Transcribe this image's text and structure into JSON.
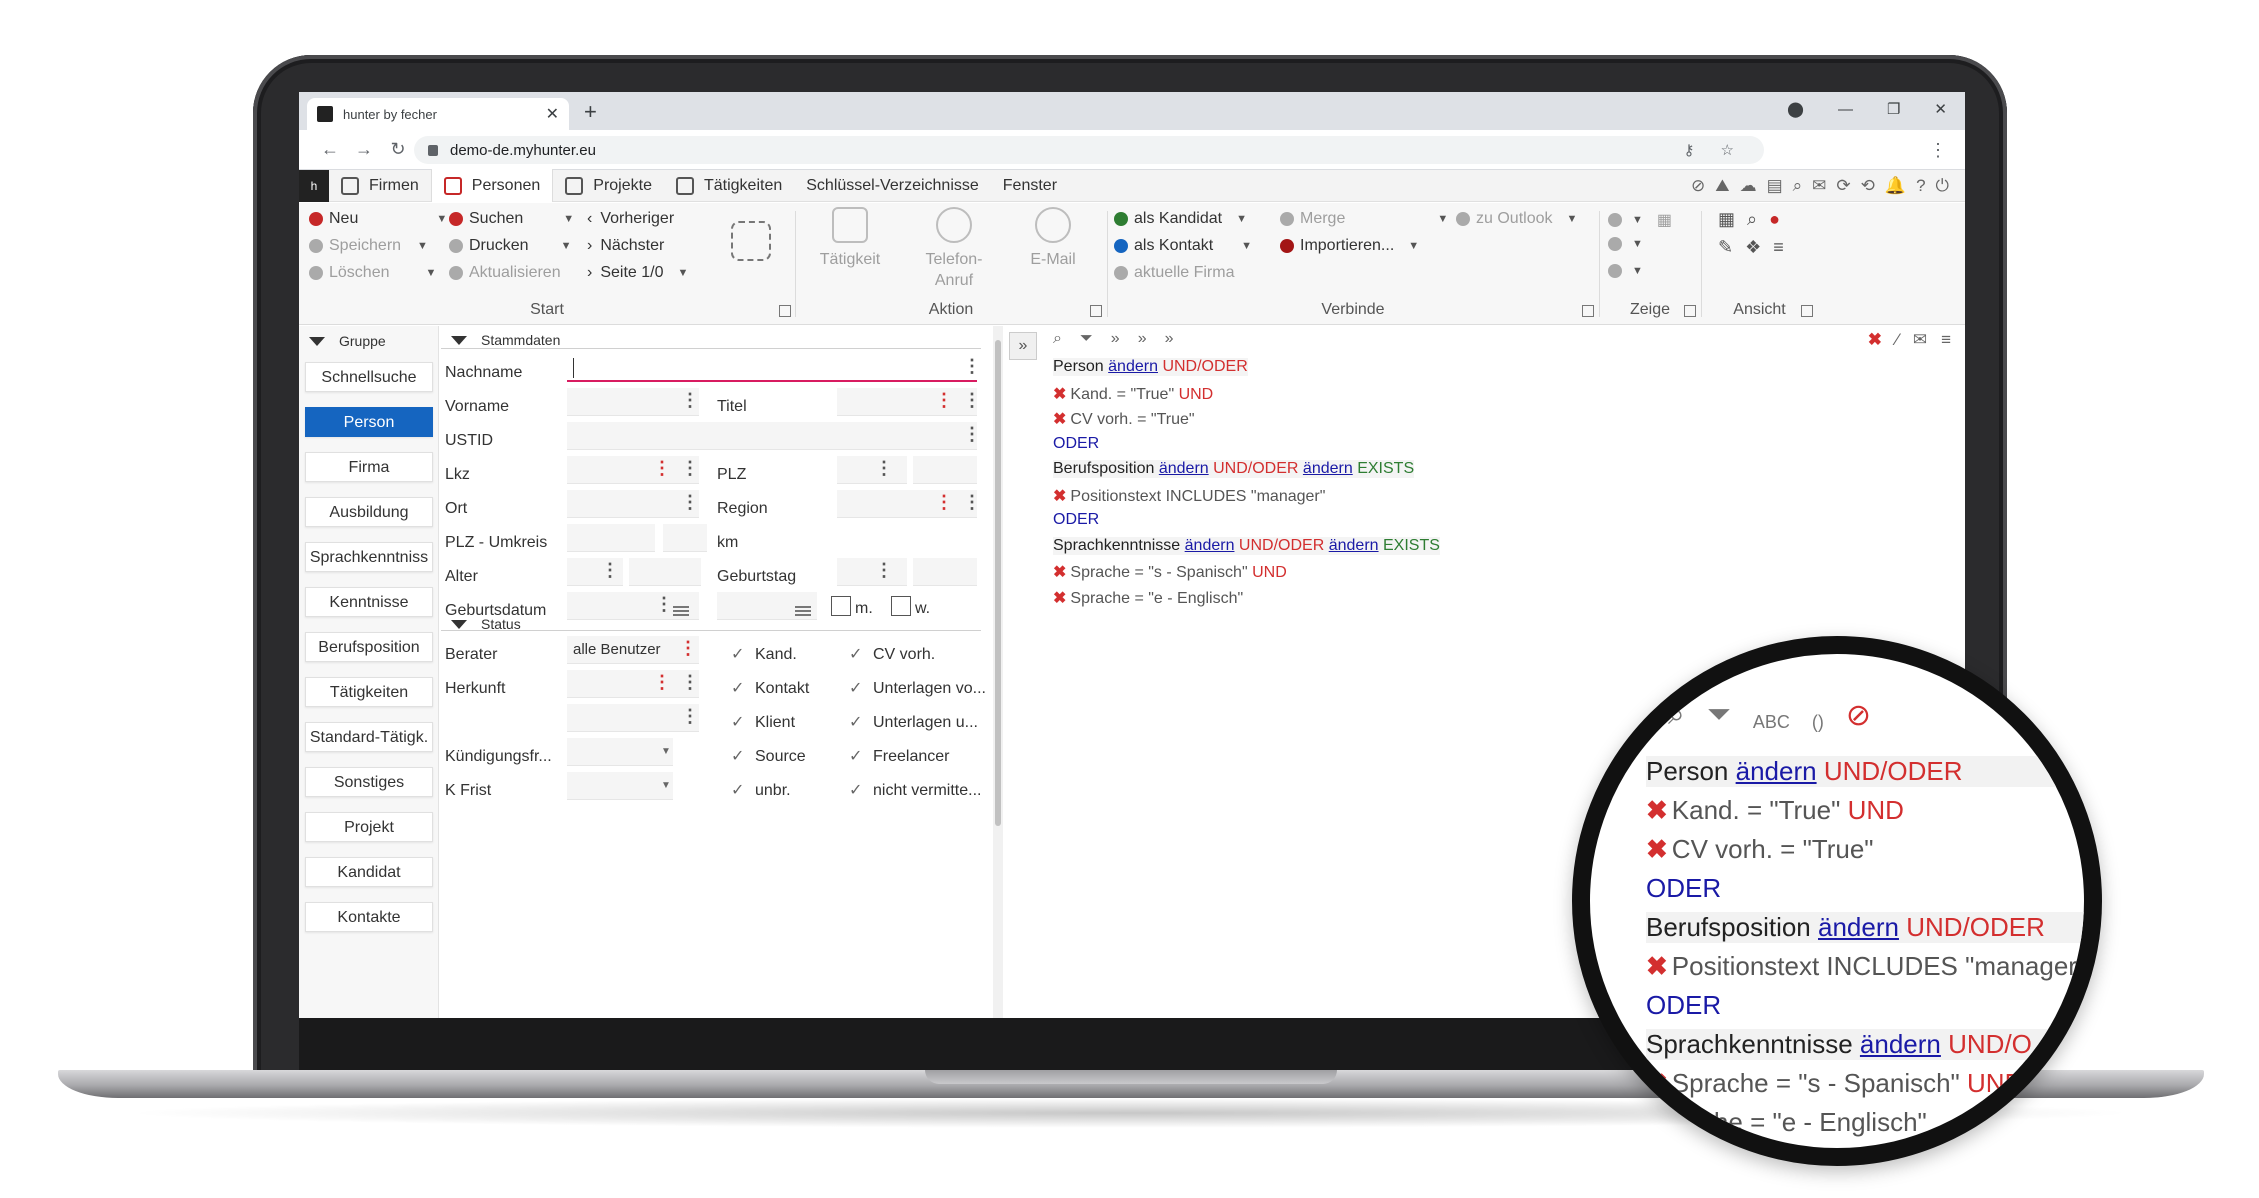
{
  "browser": {
    "tab_title": "hunter by fecher",
    "tab_close": "✕",
    "new_tab": "+",
    "url": "demo-de.myhunter.eu",
    "back": "←",
    "forward": "→",
    "reload": "↻",
    "menu": "⋮",
    "win_profile": "⬤",
    "win_min": "—",
    "win_max": "❐",
    "win_close": "✕",
    "key_icon": "⚷",
    "star_icon": "☆"
  },
  "menubar": {
    "logo": "h",
    "items": [
      {
        "label": "Firmen",
        "icon": "building-icon"
      },
      {
        "label": "Personen",
        "icon": "person-search-icon"
      },
      {
        "label": "Projekte",
        "icon": "project-icon"
      },
      {
        "label": "Tätigkeiten",
        "icon": "calendar-icon"
      },
      {
        "label": "Schlüssel-Verzeichnisse",
        "icon": ""
      },
      {
        "label": "Fenster",
        "icon": ""
      }
    ],
    "right_icons": [
      "⊘",
      "⛰",
      "☁",
      "▤",
      "⌕",
      "✉",
      "⟳",
      "⟲",
      "🔔",
      "?",
      "⏻"
    ]
  },
  "ribbon": {
    "start": {
      "label": "Start",
      "col1": [
        "Neu",
        "Speichern",
        "Löschen"
      ],
      "col2": [
        "Suchen",
        "Drucken",
        "Aktualisieren"
      ],
      "col3": [
        "Vorheriger",
        "Nächster",
        "Seite 1/0"
      ]
    },
    "aktion": {
      "label": "Aktion",
      "taetigkeit": "Tätigkeit",
      "telefon": "Telefon-\nAnruf",
      "email": "E-Mail"
    },
    "verbinde": {
      "label": "Verbinde",
      "col1": [
        "als Kandidat",
        "als Kontakt",
        "aktuelle Firma"
      ],
      "col2": [
        "Merge",
        "Importieren..."
      ],
      "col3": [
        "zu Outlook"
      ]
    },
    "zeige": {
      "label": "Zeige"
    },
    "ansicht": {
      "label": "Ansicht"
    }
  },
  "leftnav": {
    "group_label": "Gruppe",
    "items": [
      "Schnellsuche",
      "Person",
      "Firma",
      "Ausbildung",
      "Sprachkenntniss",
      "Kenntnisse",
      "Berufsposition",
      "Tätigkeiten",
      "Standard-Tätigk.",
      "Sonstiges",
      "Projekt",
      "Kandidat",
      "Kontakte"
    ],
    "selected": "Person"
  },
  "form": {
    "section_stammdaten": "Stammdaten",
    "section_status": "Status",
    "labels": {
      "nachname": "Nachname",
      "vorname": "Vorname",
      "titel": "Titel",
      "ustid": "USTID",
      "lkz": "Lkz",
      "plz": "PLZ",
      "ort": "Ort",
      "region": "Region",
      "plz_umkreis": "PLZ - Umkreis",
      "km": "km",
      "alter": "Alter",
      "geburtstag": "Geburtstag",
      "geburtsdatum": "Geburtsdatum",
      "m": "m.",
      "w": "w.",
      "berater": "Berater",
      "herkunft": "Herkunft",
      "kuendigungsfr": "Kündigungsfr...",
      "k_frist": "K Frist"
    },
    "berater_value": "alle Benutzer",
    "status_checks": [
      {
        "label": "Kand.",
        "checked": true
      },
      {
        "label": "CV vorh.",
        "checked": true
      },
      {
        "label": "Kontakt",
        "checked": true
      },
      {
        "label": "Unterlagen vo...",
        "checked": true
      },
      {
        "label": "Klient",
        "checked": true
      },
      {
        "label": "Unterlagen u...",
        "checked": true
      },
      {
        "label": "Source",
        "checked": true
      },
      {
        "label": "Freelancer",
        "checked": true
      },
      {
        "label": "unbr.",
        "checked": true
      },
      {
        "label": "nicht vermitte...",
        "checked": true
      }
    ]
  },
  "query": {
    "expand": "»",
    "lines": [
      {
        "parts": [
          {
            "t": "Person",
            "c": "b"
          },
          {
            "t": " "
          },
          {
            "t": "ändern",
            "c": "link"
          },
          {
            "t": " "
          },
          {
            "t": "UND/ODER",
            "c": "red"
          }
        ]
      },
      {
        "parts": [
          {
            "t": "✖",
            "c": "x"
          },
          {
            "t": "Kand. = \"True\" ",
            "c": "grey"
          },
          {
            "t": "UND",
            "c": "red"
          }
        ]
      },
      {
        "parts": [
          {
            "t": "✖",
            "c": "x"
          },
          {
            "t": "CV vorh. = \"True\"",
            "c": "grey"
          }
        ]
      },
      {
        "parts": [
          {
            "t": "ODER",
            "c": "blue"
          }
        ]
      },
      {
        "parts": [
          {
            "t": "Berufsposition",
            "c": "b"
          },
          {
            "t": " "
          },
          {
            "t": "ändern",
            "c": "link"
          },
          {
            "t": " "
          },
          {
            "t": "UND/ODER",
            "c": "red"
          },
          {
            "t": " "
          },
          {
            "t": "ändern",
            "c": "link"
          },
          {
            "t": " "
          },
          {
            "t": "EXISTS",
            "c": "green"
          }
        ]
      },
      {
        "parts": [
          {
            "t": "✖",
            "c": "x"
          },
          {
            "t": "Positionstext INCLUDES \"manager\"",
            "c": "grey"
          }
        ]
      },
      {
        "parts": [
          {
            "t": "ODER",
            "c": "blue"
          }
        ]
      },
      {
        "parts": [
          {
            "t": "Sprachkenntnisse",
            "c": "b"
          },
          {
            "t": " "
          },
          {
            "t": "ändern",
            "c": "link"
          },
          {
            "t": " "
          },
          {
            "t": "UND/ODER",
            "c": "red"
          },
          {
            "t": " "
          },
          {
            "t": "ändern",
            "c": "link"
          },
          {
            "t": " "
          },
          {
            "t": "EXISTS",
            "c": "green"
          }
        ]
      },
      {
        "parts": [
          {
            "t": "✖",
            "c": "x"
          },
          {
            "t": "Sprache = \"s - Spanisch\" ",
            "c": "grey"
          },
          {
            "t": "UND",
            "c": "red"
          }
        ]
      },
      {
        "parts": [
          {
            "t": "✖",
            "c": "x"
          },
          {
            "t": "Sprache = \"e - Englisch\"",
            "c": "grey"
          }
        ]
      }
    ]
  },
  "magnifier": {
    "tools": [
      "⌕",
      "⏷",
      "ABC",
      "()",
      "⊘"
    ],
    "lines": [
      {
        "parts": [
          {
            "t": "Person",
            "c": "b"
          },
          {
            "t": " "
          },
          {
            "t": "ändern",
            "c": "link"
          },
          {
            "t": " "
          },
          {
            "t": "UND/ODER",
            "c": "red"
          }
        ]
      },
      {
        "parts": [
          {
            "t": "✖",
            "c": "x"
          },
          {
            "t": "Kand. = \"True\" ",
            "c": "grey"
          },
          {
            "t": "UND",
            "c": "red"
          }
        ]
      },
      {
        "parts": [
          {
            "t": "✖",
            "c": "x"
          },
          {
            "t": "CV vorh. = \"True\"",
            "c": "grey"
          }
        ]
      },
      {
        "parts": [
          {
            "t": "ODER",
            "c": "blue"
          }
        ]
      },
      {
        "parts": [
          {
            "t": "Berufsposition",
            "c": "b"
          },
          {
            "t": " "
          },
          {
            "t": "ändern",
            "c": "link"
          },
          {
            "t": " "
          },
          {
            "t": "UND/ODER",
            "c": "red"
          }
        ]
      },
      {
        "parts": [
          {
            "t": "✖",
            "c": "x"
          },
          {
            "t": "Positionstext INCLUDES \"manager",
            "c": "grey"
          }
        ]
      },
      {
        "parts": [
          {
            "t": "ODER",
            "c": "blue"
          }
        ]
      },
      {
        "parts": [
          {
            "t": "Sprachkenntnisse",
            "c": "b"
          },
          {
            "t": " "
          },
          {
            "t": "ändern",
            "c": "link"
          },
          {
            "t": " "
          },
          {
            "t": "UND/O",
            "c": "red"
          }
        ]
      },
      {
        "parts": [
          {
            "t": "✖",
            "c": "x"
          },
          {
            "t": "Sprache = \"s - Spanisch\" ",
            "c": "grey"
          },
          {
            "t": "UND",
            "c": "red"
          }
        ]
      },
      {
        "parts": [
          {
            "t": "Sprache = \"e - Englisch\"",
            "c": "grey"
          }
        ]
      }
    ]
  }
}
